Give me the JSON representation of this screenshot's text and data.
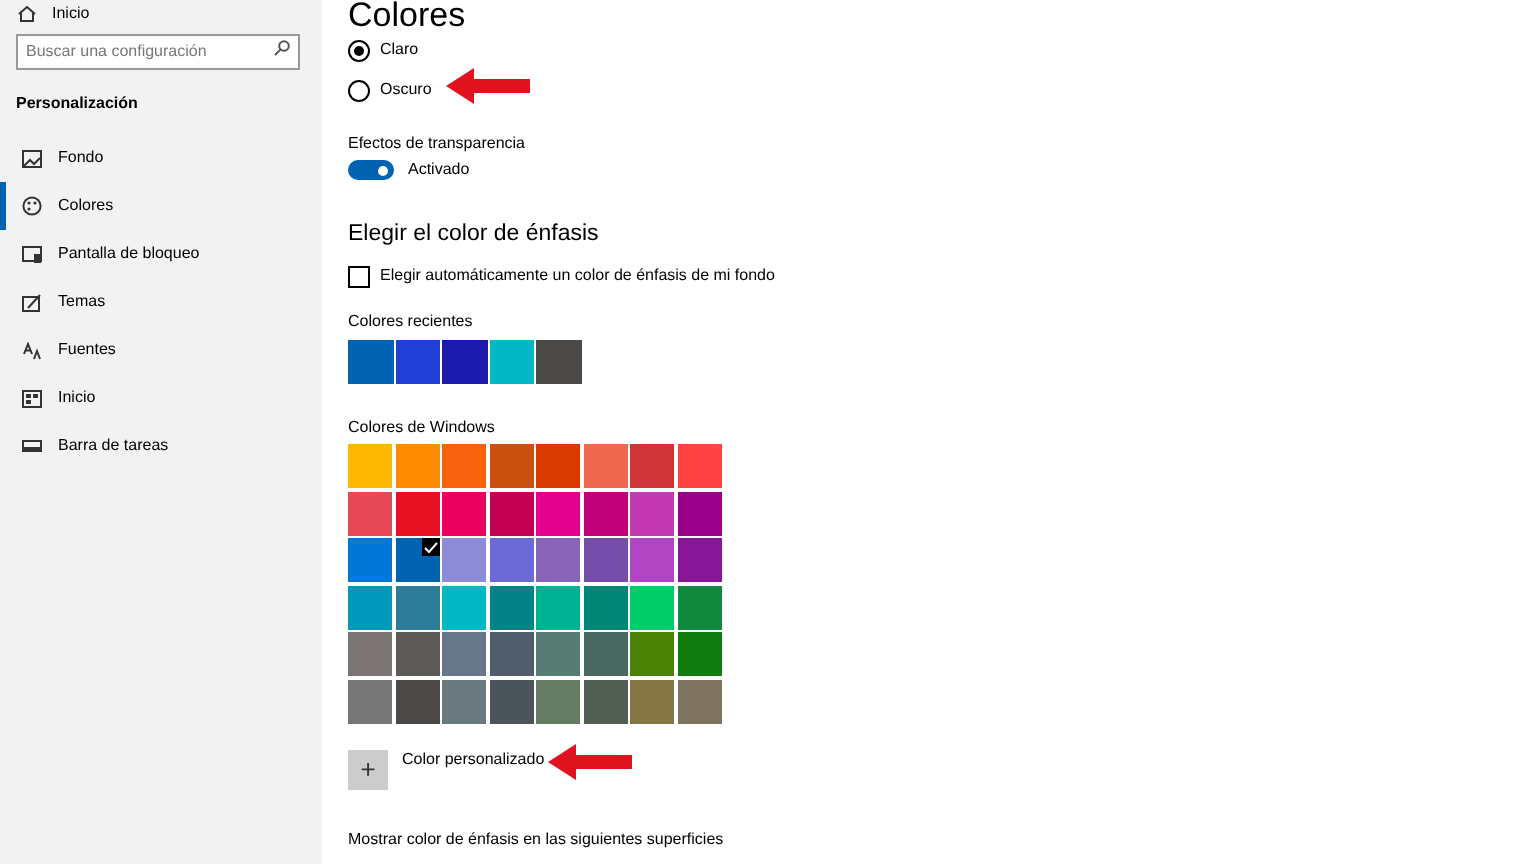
{
  "sidebar": {
    "home": "Inicio",
    "search": {
      "placeholder": "Buscar una configuración"
    },
    "section": "Personalización",
    "items": [
      {
        "label": "Fondo",
        "selected": false
      },
      {
        "label": "Colores",
        "selected": true
      },
      {
        "label": "Pantalla de bloqueo",
        "selected": false
      },
      {
        "label": "Temas",
        "selected": false
      },
      {
        "label": "Fuentes",
        "selected": false
      },
      {
        "label": "Inicio",
        "selected": false
      },
      {
        "label": "Barra de tareas",
        "selected": false
      }
    ]
  },
  "main": {
    "title": "Colores",
    "modes": [
      {
        "label": "Claro",
        "selected": true
      },
      {
        "label": "Oscuro",
        "selected": false
      }
    ],
    "transparency": {
      "label": "Efectos de transparencia",
      "on": true,
      "state": "Activado"
    },
    "accent_heading": "Elegir el color de énfasis",
    "auto_accent": {
      "label": "Elegir automáticamente un color de énfasis de mi fondo",
      "checked": false
    },
    "recent_label": "Colores recientes",
    "recent": [
      {
        "color": "#0063b1"
      },
      {
        "color": "#1f3fd6"
      },
      {
        "color": "#1a1aad"
      },
      {
        "color": "#00b7c3"
      },
      {
        "color": "#4c4a48"
      }
    ],
    "windows_label": "Colores de Windows",
    "windows_colors": [
      {
        "color": "#ffb900",
        "selected": false
      },
      {
        "color": "#ff8c00",
        "selected": false
      },
      {
        "color": "#f7630c",
        "selected": false
      },
      {
        "color": "#ca5010",
        "selected": false
      },
      {
        "color": "#da3b01",
        "selected": false
      },
      {
        "color": "#ef6950",
        "selected": false
      },
      {
        "color": "#d13438",
        "selected": false
      },
      {
        "color": "#ff4343",
        "selected": false
      },
      {
        "color": "#e74856",
        "selected": false
      },
      {
        "color": "#e81123",
        "selected": false
      },
      {
        "color": "#ea005e",
        "selected": false
      },
      {
        "color": "#c30052",
        "selected": false
      },
      {
        "color": "#e3008c",
        "selected": false
      },
      {
        "color": "#bf0077",
        "selected": false
      },
      {
        "color": "#c239b3",
        "selected": false
      },
      {
        "color": "#9a0089",
        "selected": false
      },
      {
        "color": "#0078d7",
        "selected": false
      },
      {
        "color": "#0063b1",
        "selected": true
      },
      {
        "color": "#8e8cd8",
        "selected": false
      },
      {
        "color": "#6b69d6",
        "selected": false
      },
      {
        "color": "#8764b8",
        "selected": false
      },
      {
        "color": "#744da9",
        "selected": false
      },
      {
        "color": "#b146c2",
        "selected": false
      },
      {
        "color": "#881798",
        "selected": false
      },
      {
        "color": "#0099bc",
        "selected": false
      },
      {
        "color": "#2d7d9a",
        "selected": false
      },
      {
        "color": "#00b7c3",
        "selected": false
      },
      {
        "color": "#038387",
        "selected": false
      },
      {
        "color": "#00b294",
        "selected": false
      },
      {
        "color": "#018574",
        "selected": false
      },
      {
        "color": "#00cc6a",
        "selected": false
      },
      {
        "color": "#10893e",
        "selected": false
      },
      {
        "color": "#7a7574",
        "selected": false
      },
      {
        "color": "#5d5a58",
        "selected": false
      },
      {
        "color": "#68768a",
        "selected": false
      },
      {
        "color": "#515c6b",
        "selected": false
      },
      {
        "color": "#567c73",
        "selected": false
      },
      {
        "color": "#486860",
        "selected": false
      },
      {
        "color": "#498205",
        "selected": false
      },
      {
        "color": "#107c10",
        "selected": false
      },
      {
        "color": "#767676",
        "selected": false
      },
      {
        "color": "#4c4a48",
        "selected": false
      },
      {
        "color": "#69797e",
        "selected": false
      },
      {
        "color": "#4a5459",
        "selected": false
      },
      {
        "color": "#647c64",
        "selected": false
      },
      {
        "color": "#525e54",
        "selected": false
      },
      {
        "color": "#847545",
        "selected": false
      },
      {
        "color": "#7e735f",
        "selected": false
      }
    ],
    "custom": {
      "symbol": "+",
      "label": "Color personalizado"
    },
    "surfaces_label": "Mostrar color de énfasis en las siguientes superficies"
  }
}
